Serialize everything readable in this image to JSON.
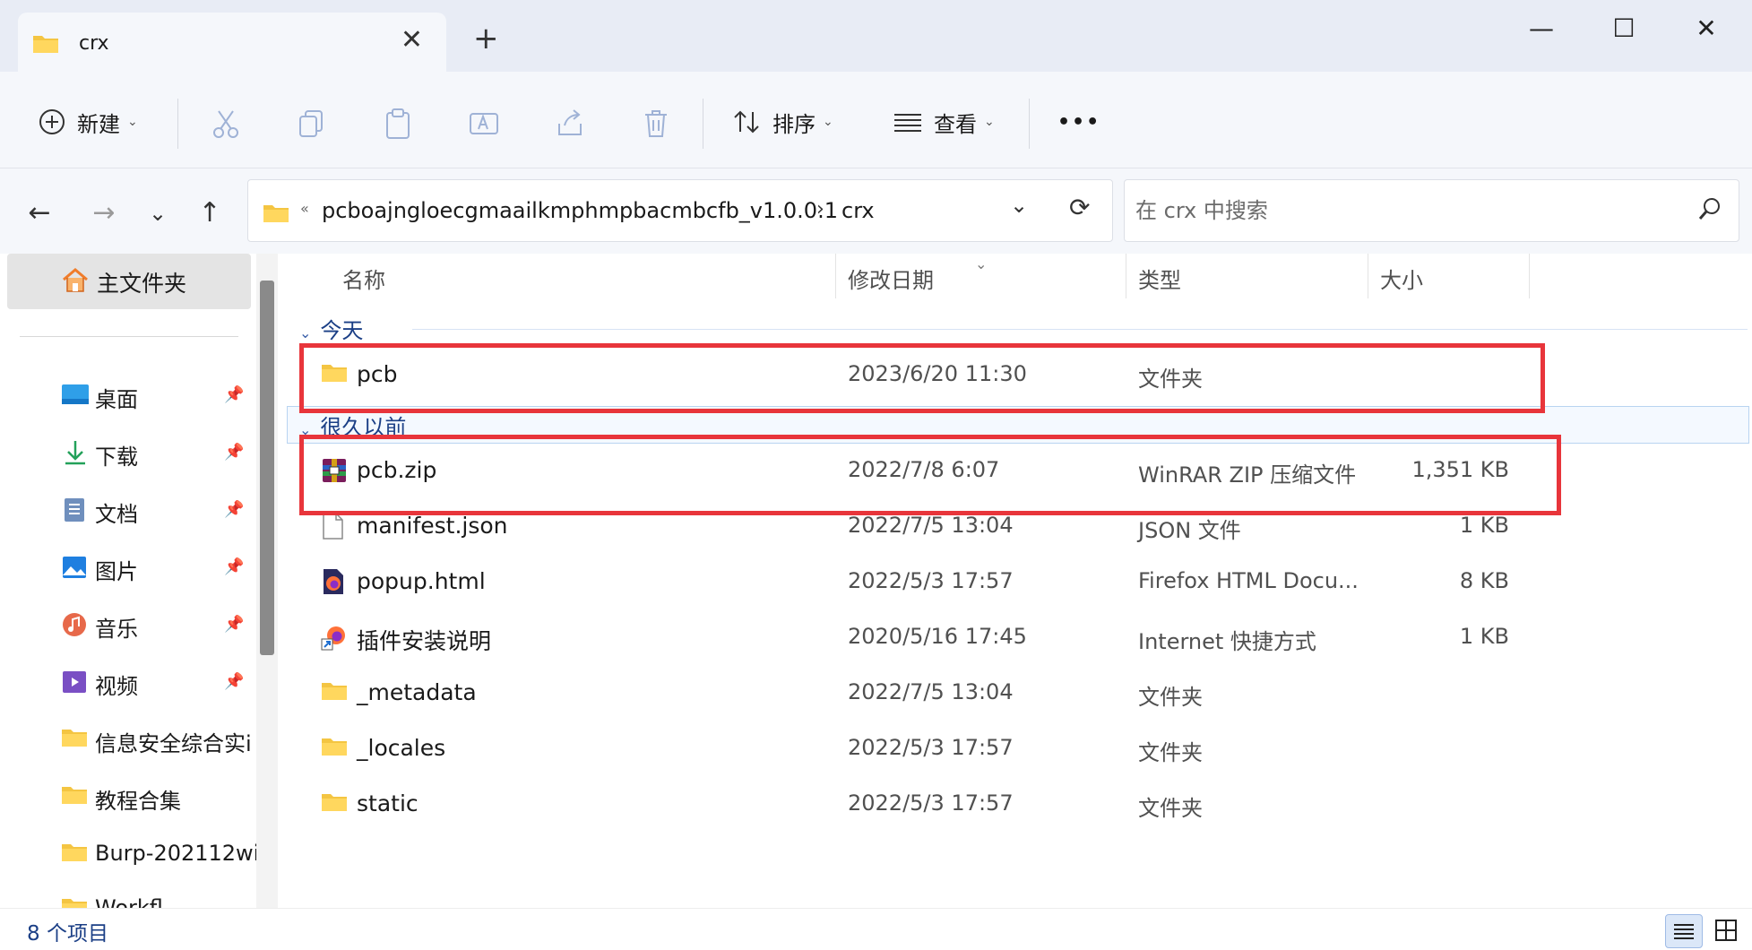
{
  "window": {
    "tab_title": "crx",
    "new_tab_symbol": "+",
    "close_tab_symbol": "✕",
    "minimize_symbol": "—",
    "maximize_symbol": "☐",
    "close_symbol": "✕"
  },
  "commandbar": {
    "new_label": "新建",
    "sort_label": "排序",
    "view_label": "查看",
    "more_symbol": "•••"
  },
  "address": {
    "overflow_symbol": "«",
    "crumbs": [
      "pcboajngloecgmaailkmphmpbacmbcfb_v1.0.0.1",
      "crx"
    ],
    "crumb_separator": "›",
    "search_placeholder": "在 crx 中搜索"
  },
  "sidebar": {
    "home_label": "主文件夹",
    "pin_symbol": "📌",
    "items": [
      {
        "label": "桌面",
        "icon": "desktop-icon",
        "pinned": true
      },
      {
        "label": "下载",
        "icon": "download-icon",
        "pinned": true
      },
      {
        "label": "文档",
        "icon": "document-icon",
        "pinned": true
      },
      {
        "label": "图片",
        "icon": "pictures-icon",
        "pinned": true
      },
      {
        "label": "音乐",
        "icon": "music-icon",
        "pinned": true
      },
      {
        "label": "视频",
        "icon": "video-icon",
        "pinned": true
      },
      {
        "label": "信息安全综合实i",
        "icon": "folder-icon",
        "pinned": false
      },
      {
        "label": "教程合集",
        "icon": "folder-icon",
        "pinned": false
      },
      {
        "label": "Burp-202112wi",
        "icon": "folder-icon",
        "pinned": false
      },
      {
        "label": "Workfl",
        "icon": "folder-icon",
        "pinned": false
      }
    ]
  },
  "columns": {
    "name": "名称",
    "date": "修改日期",
    "type": "类型",
    "size": "大小"
  },
  "groups": {
    "today": "今天",
    "long_ago": "很久以前"
  },
  "files": [
    {
      "name": "pcb",
      "date": "2023/6/20 11:30",
      "type": "文件夹",
      "size": "",
      "icon": "folder-icon"
    },
    {
      "name": "pcb.zip",
      "date": "2022/7/8 6:07",
      "type": "WinRAR ZIP 压缩文件",
      "size": "1,351 KB",
      "icon": "winrar-icon"
    },
    {
      "name": "manifest.json",
      "date": "2022/7/5 13:04",
      "type": "JSON 文件",
      "size": "1 KB",
      "icon": "file-icon"
    },
    {
      "name": "popup.html",
      "date": "2022/5/3 17:57",
      "type": "Firefox HTML Docu...",
      "size": "8 KB",
      "icon": "firefox-icon"
    },
    {
      "name": "插件安装说明",
      "date": "2020/5/16 17:45",
      "type": "Internet 快捷方式",
      "size": "1 KB",
      "icon": "internet-shortcut-icon"
    },
    {
      "name": "_metadata",
      "date": "2022/7/5 13:04",
      "type": "文件夹",
      "size": "",
      "icon": "folder-icon"
    },
    {
      "name": "_locales",
      "date": "2022/5/3 17:57",
      "type": "文件夹",
      "size": "",
      "icon": "folder-icon"
    },
    {
      "name": "static",
      "date": "2022/5/3 17:57",
      "type": "文件夹",
      "size": "",
      "icon": "folder-icon"
    }
  ],
  "status": {
    "item_count": "8 个项目"
  },
  "colors": {
    "accent": "#1b3f86",
    "highlight_box": "#e8353b",
    "folder": "#f4c542"
  }
}
